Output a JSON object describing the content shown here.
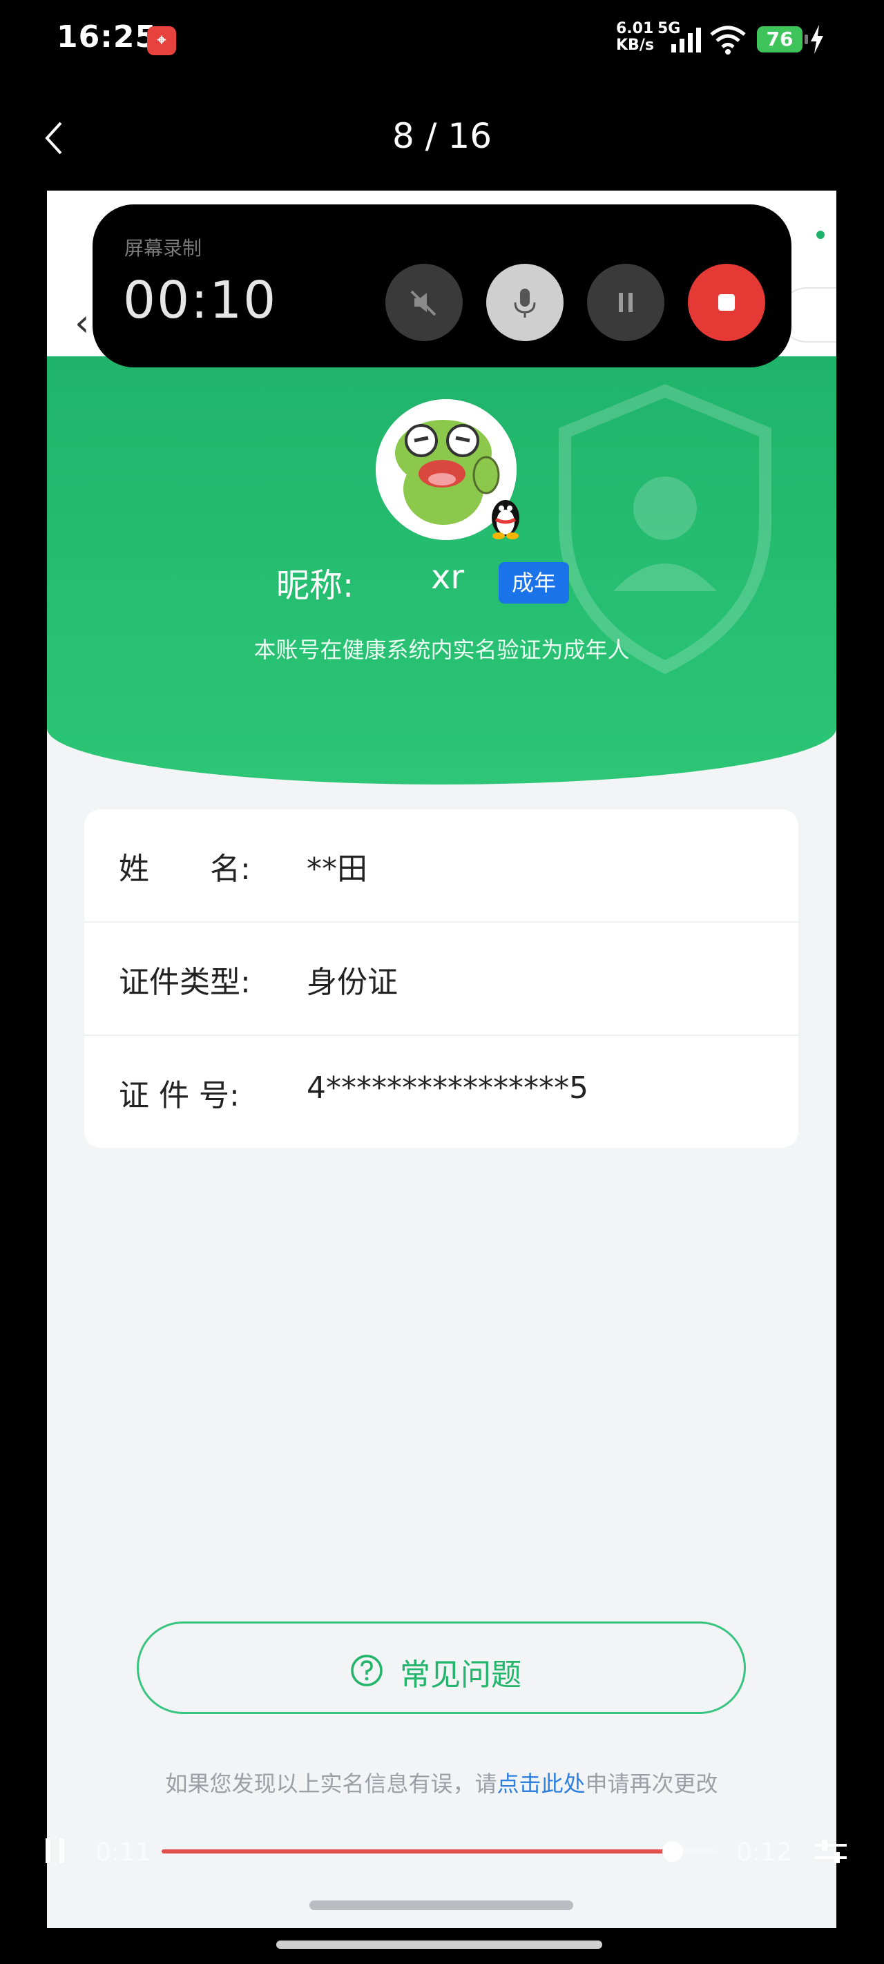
{
  "status_bar": {
    "time": "16:25",
    "net_speed": "6.01",
    "net_unit": "KB/s",
    "net_type": "5G",
    "battery": "76",
    "app_icon": "location-app-icon"
  },
  "viewer": {
    "page_counter": "8 / 16"
  },
  "screen_recorder": {
    "label": "屏幕录制",
    "time": "00:10"
  },
  "profile": {
    "nickname_label": "昵称:",
    "nickname": "xr",
    "badge": "成年",
    "verify_note": "本账号在健康系统内实名验证为成年人"
  },
  "info": {
    "rows": [
      {
        "label": "姓　　名:",
        "value": "**田"
      },
      {
        "label": "证件类型:",
        "value": "身份证"
      },
      {
        "label": "证  件  号:",
        "value": "4****************5"
      }
    ]
  },
  "faq": {
    "label": "常见问题"
  },
  "footer": {
    "note_before": "如果您发现以上实名信息有误，请",
    "link": "点击此处",
    "note_after": "申请再次更改"
  },
  "player": {
    "current": "0:11",
    "total": "0:12",
    "progress": 0.92
  },
  "colors": {
    "brand_green": "#1fb46a",
    "badge_blue": "#1a73e8",
    "progress_red": "#e25050",
    "link_blue": "#2f7fe0"
  }
}
